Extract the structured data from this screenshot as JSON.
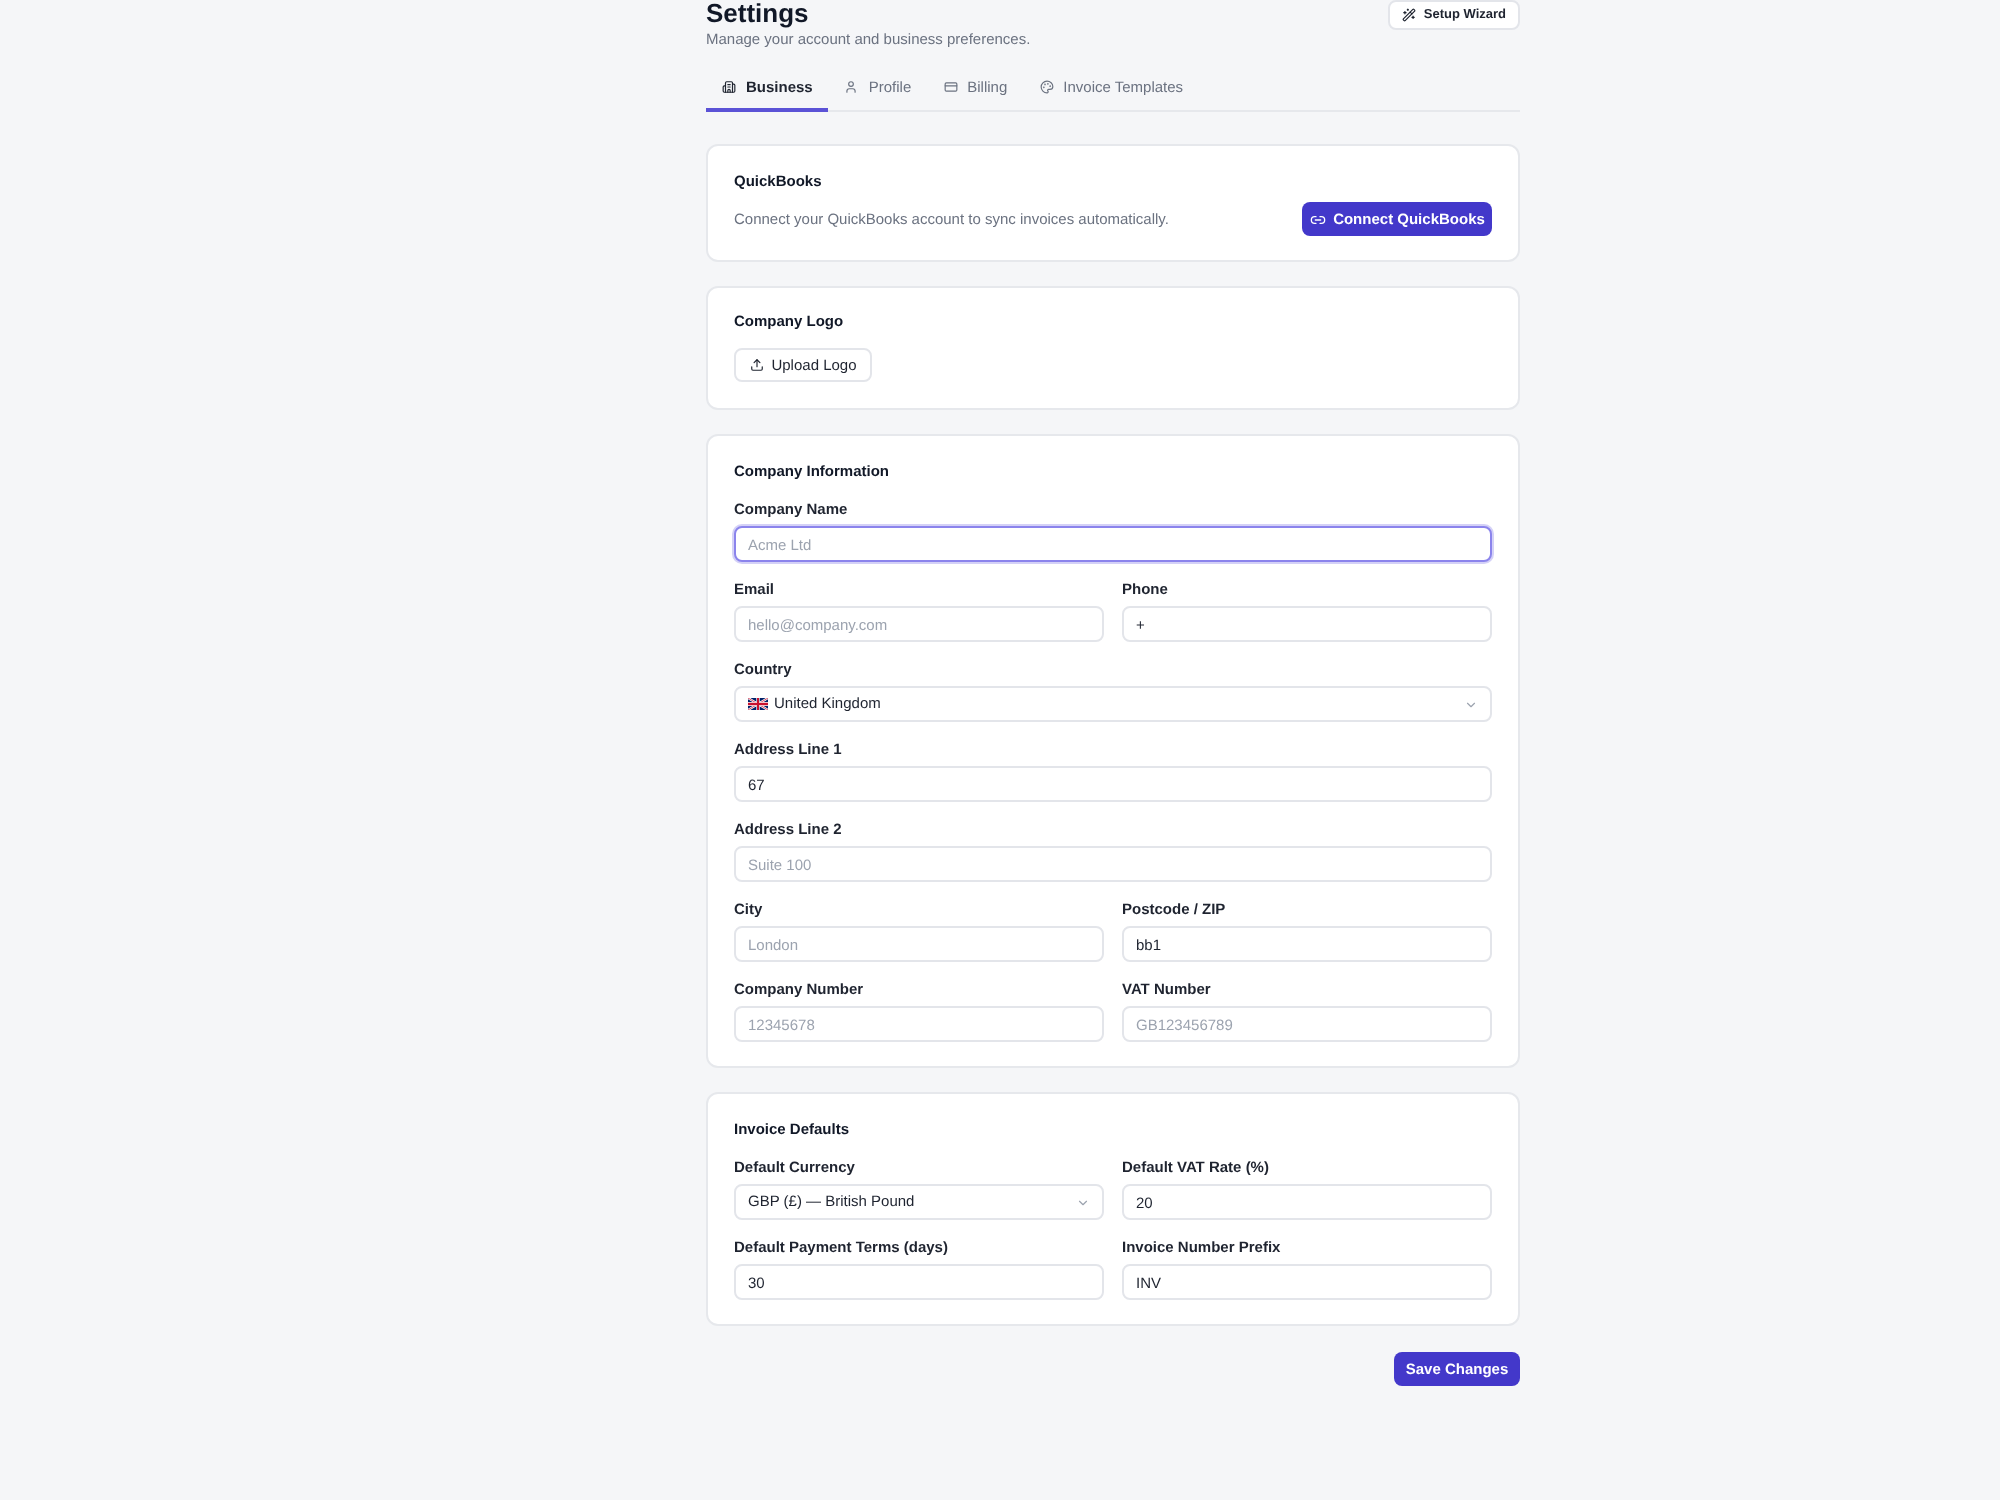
{
  "header": {
    "title": "Settings",
    "subtitle": "Manage your account and business preferences.",
    "action": "Setup Wizard"
  },
  "tabs": [
    {
      "label": "Business",
      "selected": true
    },
    {
      "label": "Profile",
      "selected": false
    },
    {
      "label": "Billing",
      "selected": false
    },
    {
      "label": "Invoice Templates",
      "selected": false
    }
  ],
  "quickbooks": {
    "title": "QuickBooks",
    "description": "Connect your QuickBooks account to sync invoices automatically.",
    "button": "Connect QuickBooks"
  },
  "company_logo": {
    "title": "Company Logo",
    "button": "Upload Logo"
  },
  "company_information": {
    "title": "Company Information",
    "rows": [
      [
        {
          "label": "Company Name",
          "kind": "input",
          "placeholder": "Acme Ltd",
          "focused": true
        }
      ],
      [
        {
          "label": "Email",
          "kind": "input",
          "placeholder": "hello@company.com",
          "focused": false
        },
        {
          "label": "Phone",
          "kind": "input",
          "value": "+",
          "focused": false
        }
      ],
      [
        {
          "label": "Country",
          "kind": "select",
          "value": "United Kingdom",
          "flag": true,
          "focused": false
        }
      ],
      [
        {
          "label": "Address Line 1",
          "kind": "input",
          "value": "67",
          "focused": false
        }
      ],
      [
        {
          "label": "Address Line 2",
          "kind": "input",
          "placeholder": "Suite 100",
          "focused": false
        }
      ],
      [
        {
          "label": "City",
          "kind": "input",
          "placeholder": "London",
          "focused": false
        },
        {
          "label": "Postcode / ZIP",
          "kind": "input",
          "value": "bb1",
          "focused": false
        }
      ],
      [
        {
          "label": "Company Number",
          "kind": "input",
          "placeholder": "12345678",
          "focused": false
        },
        {
          "label": "VAT Number",
          "kind": "input",
          "placeholder": "GB123456789",
          "focused": false
        }
      ]
    ]
  },
  "invoice_defaults": {
    "title": "Invoice Defaults",
    "rows": [
      [
        {
          "label": "Default Currency",
          "kind": "select",
          "value": "GBP (£) — British Pound",
          "focused": false
        },
        {
          "label": "Default VAT Rate (%)",
          "kind": "input",
          "value": "20",
          "focused": false
        }
      ],
      [
        {
          "label": "Default Payment Terms (days)",
          "kind": "input",
          "value": "30",
          "focused": false
        },
        {
          "label": "Invoice Number Prefix",
          "kind": "input",
          "value": "INV",
          "focused": false
        }
      ]
    ]
  },
  "save_button": "Save Changes"
}
